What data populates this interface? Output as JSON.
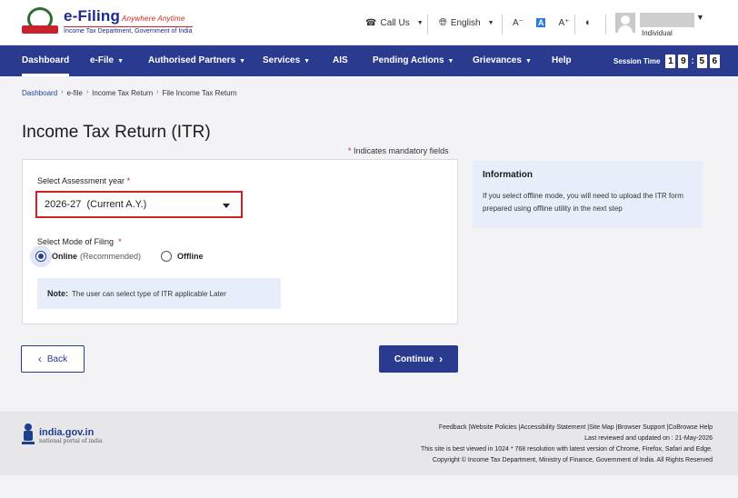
{
  "header": {
    "brand_name": "e-Filing",
    "brand_tagline": "Anywhere Anytime",
    "brand_dept": "Income Tax Department, Government of India",
    "call_us": "Call Us",
    "language": "English",
    "font_decrease": "A⁻",
    "font_normal": "A",
    "font_increase": "A⁺",
    "user_role": "Individual"
  },
  "nav": {
    "items": [
      "Dashboard",
      "e-File",
      "Authorised Partners",
      "Services",
      "AIS",
      "Pending Actions",
      "Grievances",
      "Help"
    ],
    "session_label": "Session Time",
    "session_digits": [
      "1",
      "9",
      "5",
      "6"
    ]
  },
  "breadcrumb": [
    "Dashboard",
    "e-file",
    "Income Tax Return",
    "File Income Tax Return"
  ],
  "page": {
    "title": "Income Tax Return (ITR)",
    "mandatory_note": "Indicates mandatory fields"
  },
  "form": {
    "assessment_label": "Select Assessment year",
    "assessment_value": "2026-27  (Current A.Y.)",
    "mode_label": "Select Mode of Filing",
    "online_label": "Online",
    "online_hint": "(Recommended)",
    "offline_label": "Offline",
    "note_title": "Note:",
    "note_text": "The user can select type of ITR applicable Later"
  },
  "info": {
    "title": "Information",
    "text": "If you select offline mode, you will need to upload the ITR form prepared using offline utility in the next step"
  },
  "buttons": {
    "back": "Back",
    "continue": "Continue"
  },
  "footer": {
    "site": "india.gov.in",
    "site_sub": "national portal of india",
    "links": "Feedback |Website Policies |Accessibility Statement |Site Map |Browser Support |CoBrowse Help",
    "updated": "Last reviewed and updated on : 21-May-2026",
    "best_viewed": "This site is best viewed in 1024 * 768 resolution with latest version of Chrome, Firefox, Safari and Edge.",
    "copyright": "Copyright © Income Tax Department, Ministry of Finance, Government of India. All Rights Reserved"
  },
  "colors": {
    "nav": "#2a3b8f",
    "accent_red": "#d0201f",
    "info_bg": "#e8eef9"
  }
}
